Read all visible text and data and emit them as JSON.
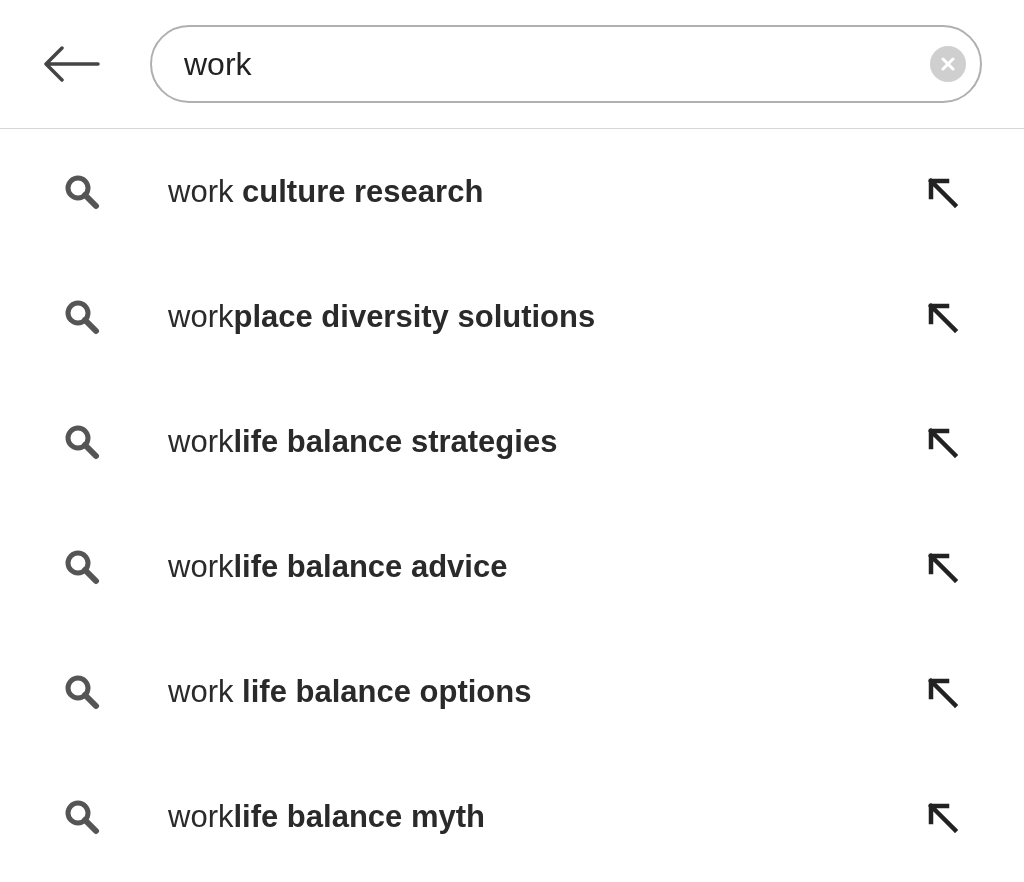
{
  "search": {
    "value": "work"
  },
  "suggestions": [
    {
      "text": "work **culture research**"
    },
    {
      "text": "work**place diversity solutions**"
    },
    {
      "text": "work**life balance strategies**"
    },
    {
      "text": "work**life balance advice**"
    },
    {
      "text": "work **life balance options**"
    },
    {
      "text": "work**life balance myth**"
    }
  ]
}
